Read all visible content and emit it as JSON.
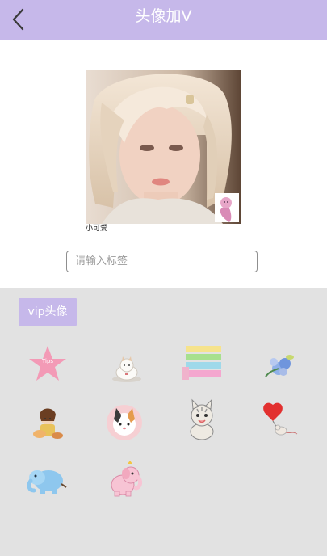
{
  "header": {
    "title": "头像加V",
    "back_icon": "chevron-left-icon"
  },
  "avatar": {
    "caption": "小可爱",
    "badge_icon": "mermaid-badge-icon"
  },
  "tag_input": {
    "placeholder": "请输入标签",
    "value": ""
  },
  "vip_section": {
    "label": "vip头像",
    "stickers": [
      "pink-star-tips-icon",
      "white-cat-icon",
      "pastel-bars-icon",
      "blue-flower-icon",
      "girl-with-dog-icon",
      "calico-cat-icon",
      "tabby-kitten-icon",
      "heart-balloon-mouse-icon",
      "blue-elephant-icon",
      "pink-elephant-icon"
    ]
  },
  "colors": {
    "accent": "#c6b8ea",
    "panel_bg": "#e2e2e2"
  }
}
